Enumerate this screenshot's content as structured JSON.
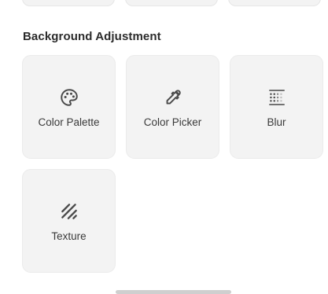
{
  "section": {
    "title": "Background Adjustment"
  },
  "options": [
    {
      "label": "Color Palette",
      "icon": "palette-icon"
    },
    {
      "label": "Color Picker",
      "icon": "eyedropper-icon"
    },
    {
      "label": "Blur",
      "icon": "blur-icon"
    },
    {
      "label": "Texture",
      "icon": "texture-icon"
    }
  ],
  "colors": {
    "card_background": "#f3f3f3",
    "icon": "#4a4a4a",
    "text": "#2b2b2b"
  }
}
